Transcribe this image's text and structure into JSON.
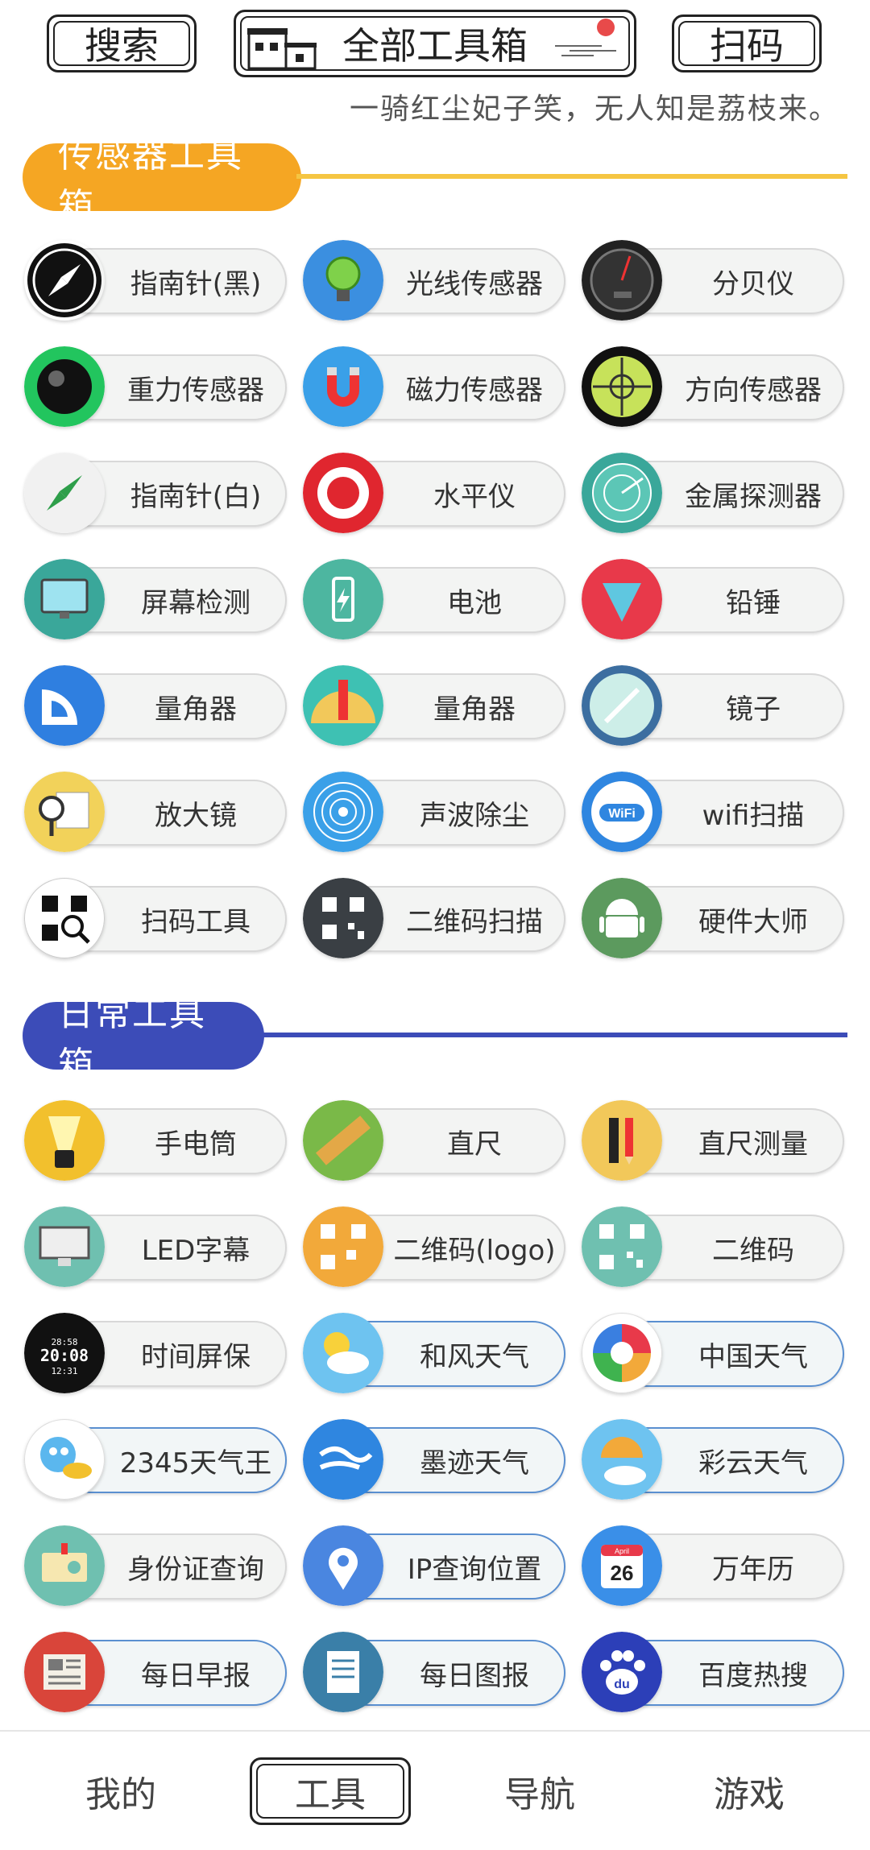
{
  "header": {
    "search_label": "搜索",
    "title": "全部工具箱",
    "scan_label": "扫码",
    "poem": "一骑红尘妃子笑，无人知是荔枝来。"
  },
  "sections": [
    {
      "title": "传感器工具箱",
      "accent": "#f5a623",
      "tools": [
        {
          "label": "指南针(黑)",
          "icon": "compass-black-icon",
          "color": "#111111"
        },
        {
          "label": "光线传感器",
          "icon": "light-bulb-icon",
          "color": "#3b8fe0"
        },
        {
          "label": "分贝仪",
          "icon": "decibel-meter-icon",
          "color": "#222222"
        },
        {
          "label": "重力传感器",
          "icon": "gravity-ball-icon",
          "color": "#22c55e"
        },
        {
          "label": "磁力传感器",
          "icon": "magnet-icon",
          "color": "#3aa0e8"
        },
        {
          "label": "方向传感器",
          "icon": "crosshair-icon",
          "color": "#c7e25a"
        },
        {
          "label": "指南针(白)",
          "icon": "compass-white-icon",
          "color": "#f1f1f1"
        },
        {
          "label": "水平仪",
          "icon": "target-icon",
          "color": "#e0262f"
        },
        {
          "label": "金属探测器",
          "icon": "radar-icon",
          "color": "#3aa79a"
        },
        {
          "label": "屏幕检测",
          "icon": "monitor-icon",
          "color": "#3aa79a"
        },
        {
          "label": "电池",
          "icon": "battery-icon",
          "color": "#4db6a0"
        },
        {
          "label": "铅锤",
          "icon": "plumb-bob-icon",
          "color": "#e8394a"
        },
        {
          "label": "量角器",
          "icon": "protractor-icon",
          "color": "#2f7fe0"
        },
        {
          "label": "量角器",
          "icon": "protractor-pencil-icon",
          "color": "#3ec1b3"
        },
        {
          "label": "镜子",
          "icon": "mirror-icon",
          "color": "#3c6ea0"
        },
        {
          "label": "放大镜",
          "icon": "magnifier-book-icon",
          "color": "#f2d25a"
        },
        {
          "label": "声波除尘",
          "icon": "sound-wave-icon",
          "color": "#3aa0e8"
        },
        {
          "label": "wifi扫描",
          "icon": "wifi-icon",
          "color": "#2f86e0"
        },
        {
          "label": "扫码工具",
          "icon": "qr-scan-icon",
          "color": "#ffffff"
        },
        {
          "label": "二维码扫描",
          "icon": "qr-code-icon",
          "color": "#3a3f44"
        },
        {
          "label": "硬件大师",
          "icon": "android-icon",
          "color": "#5c9a5e"
        }
      ]
    },
    {
      "title": "日常工具箱",
      "accent": "#3c4cb8",
      "tools": [
        {
          "label": "手电筒",
          "icon": "flashlight-icon",
          "color": "#f2c02d"
        },
        {
          "label": "直尺",
          "icon": "ruler-icon",
          "color": "#7ab948"
        },
        {
          "label": "直尺测量",
          "icon": "ruler-pencil-icon",
          "color": "#f2c85a"
        },
        {
          "label": "LED字幕",
          "icon": "led-monitor-icon",
          "color": "#6fc0b0"
        },
        {
          "label": "二维码(logo)",
          "icon": "qr-logo-icon",
          "color": "#f2a93a"
        },
        {
          "label": "二维码",
          "icon": "qr-code-green-icon",
          "color": "#6fc0b0"
        },
        {
          "label": "时间屏保",
          "icon": "digital-clock-icon",
          "color": "#111111"
        },
        {
          "label": "和风天气",
          "icon": "sun-cloud-icon",
          "color": "#6ec3f0"
        },
        {
          "label": "中国天气",
          "icon": "china-weather-icon",
          "color": "#ffffff"
        },
        {
          "label": "2345天气王",
          "icon": "octopus-weather-icon",
          "color": "#ffffff"
        },
        {
          "label": "墨迹天气",
          "icon": "wind-cloud-icon",
          "color": "#2f86e0"
        },
        {
          "label": "彩云天气",
          "icon": "umbrella-cloud-icon",
          "color": "#6ec3f0"
        },
        {
          "label": "身份证查询",
          "icon": "id-card-icon",
          "color": "#6fc0b0"
        },
        {
          "label": "IP查询位置",
          "icon": "location-pin-icon",
          "color": "#4a86e0"
        },
        {
          "label": "万年历",
          "icon": "calendar-icon",
          "color": "#3a8fe8"
        },
        {
          "label": "每日早报",
          "icon": "newspaper-icon",
          "color": "#d9453a"
        },
        {
          "label": "每日图报",
          "icon": "news-doc-icon",
          "color": "#3a7fa8"
        },
        {
          "label": "百度热搜",
          "icon": "baidu-paw-icon",
          "color": "#2c3fb8"
        }
      ]
    }
  ],
  "calendar": {
    "month": "April",
    "day": "26"
  },
  "clock": {
    "time": "20:08",
    "top": "28:58",
    "date": "12:31"
  },
  "nav": {
    "mine": "我的",
    "tools": "工具",
    "guide": "导航",
    "games": "游戏"
  }
}
